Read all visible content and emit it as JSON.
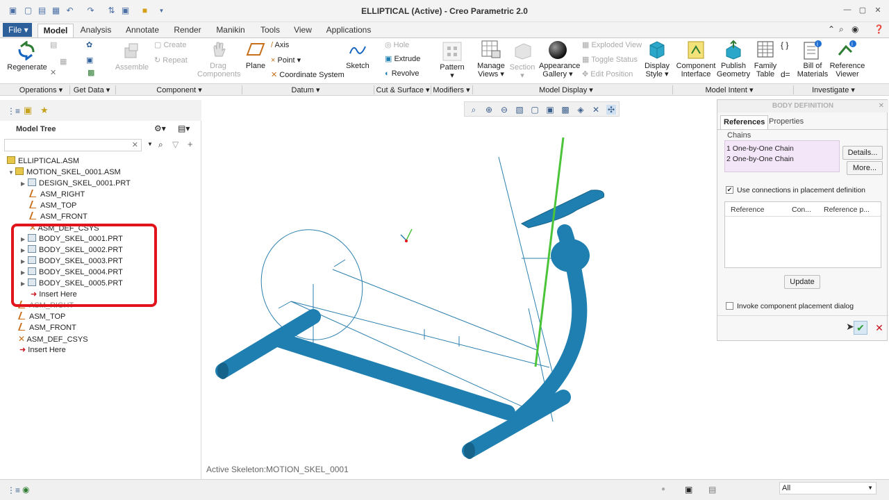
{
  "window": {
    "title": "ELLIPTICAL (Active) - Creo Parametric 2.0"
  },
  "menu": {
    "file": "File",
    "tabs": [
      "Model",
      "Analysis",
      "Annotate",
      "Render",
      "Manikin",
      "Tools",
      "View",
      "Applications"
    ],
    "active_tab": "Model"
  },
  "ribbon": {
    "regenerate": "Regenerate",
    "assemble": "Assemble",
    "create": "Create",
    "repeat": "Repeat",
    "drag_components": [
      "Drag",
      "Components"
    ],
    "plane": "Plane",
    "axis": "Axis",
    "point": "Point",
    "coordinate_system": "Coordinate System",
    "sketch": "Sketch",
    "hole": "Hole",
    "extrude": "Extrude",
    "revolve": "Revolve",
    "pattern": "Pattern",
    "manage_views": [
      "Manage",
      "Views"
    ],
    "section": "Section",
    "appearance_gallery": [
      "Appearance",
      "Gallery"
    ],
    "exploded_view": "Exploded View",
    "toggle_status": "Toggle Status",
    "edit_position": "Edit Position",
    "display_style": [
      "Display",
      "Style"
    ],
    "component_interface": [
      "Component",
      "Interface"
    ],
    "publish_geometry": [
      "Publish",
      "Geometry"
    ],
    "family_table": [
      "Family",
      "Table"
    ],
    "bill_of_materials": [
      "Bill of",
      "Materials"
    ],
    "reference_viewer": [
      "Reference",
      "Viewer"
    ],
    "groups": [
      "Operations",
      "Get Data",
      "Component",
      "Datum",
      "Cut & Surface",
      "Modifiers",
      "Model Display",
      "Model Intent",
      "Investigate"
    ]
  },
  "model_tree": {
    "title": "Model Tree",
    "search_placeholder": "",
    "items": [
      {
        "label": "ELLIPTICAL.ASM",
        "type": "asm"
      },
      {
        "label": "MOTION_SKEL_0001.ASM",
        "type": "asm"
      },
      {
        "label": "DESIGN_SKEL_0001.PRT",
        "type": "prt"
      },
      {
        "label": "ASM_RIGHT",
        "type": "plane"
      },
      {
        "label": "ASM_TOP",
        "type": "plane"
      },
      {
        "label": "ASM_FRONT",
        "type": "plane"
      },
      {
        "label": "ASM_DEF_CSYS",
        "type": "csys"
      },
      {
        "label": "BODY_SKEL_0001.PRT",
        "type": "prt"
      },
      {
        "label": "BODY_SKEL_0002.PRT",
        "type": "prt"
      },
      {
        "label": "BODY_SKEL_0003.PRT",
        "type": "prt"
      },
      {
        "label": "BODY_SKEL_0004.PRT",
        "type": "prt"
      },
      {
        "label": "BODY_SKEL_0005.PRT",
        "type": "prt"
      },
      {
        "label": "Insert Here",
        "type": "insert"
      },
      {
        "label": "ASM_RIGHT",
        "type": "plane"
      },
      {
        "label": "ASM_TOP",
        "type": "plane"
      },
      {
        "label": "ASM_FRONT",
        "type": "plane"
      },
      {
        "label": "ASM_DEF_CSYS",
        "type": "csys"
      },
      {
        "label": "Insert Here",
        "type": "insert"
      }
    ]
  },
  "graphics": {
    "status": "Active Skeleton:MOTION_SKEL_0001"
  },
  "dialog": {
    "title": "BODY DEFINITION",
    "tabs": [
      "References",
      "Properties"
    ],
    "chains_label": "Chains",
    "chains": [
      "1 One-by-One Chain",
      "2 One-by-One Chain"
    ],
    "details_button": "Details...",
    "more_button": "More...",
    "use_connections_label": "Use connections in placement definition",
    "use_connections_checked": true,
    "table_headers": [
      "Reference",
      "Con...",
      "Reference p..."
    ],
    "update_button": "Update",
    "invoke_label": "Invoke component placement dialog",
    "invoke_checked": false
  },
  "statusbar": {
    "filter": "All"
  },
  "colors": {
    "model_blue": "#1e7fb0",
    "highlight_red": "#e1131b",
    "skeleton_green": "#4cc43a"
  }
}
